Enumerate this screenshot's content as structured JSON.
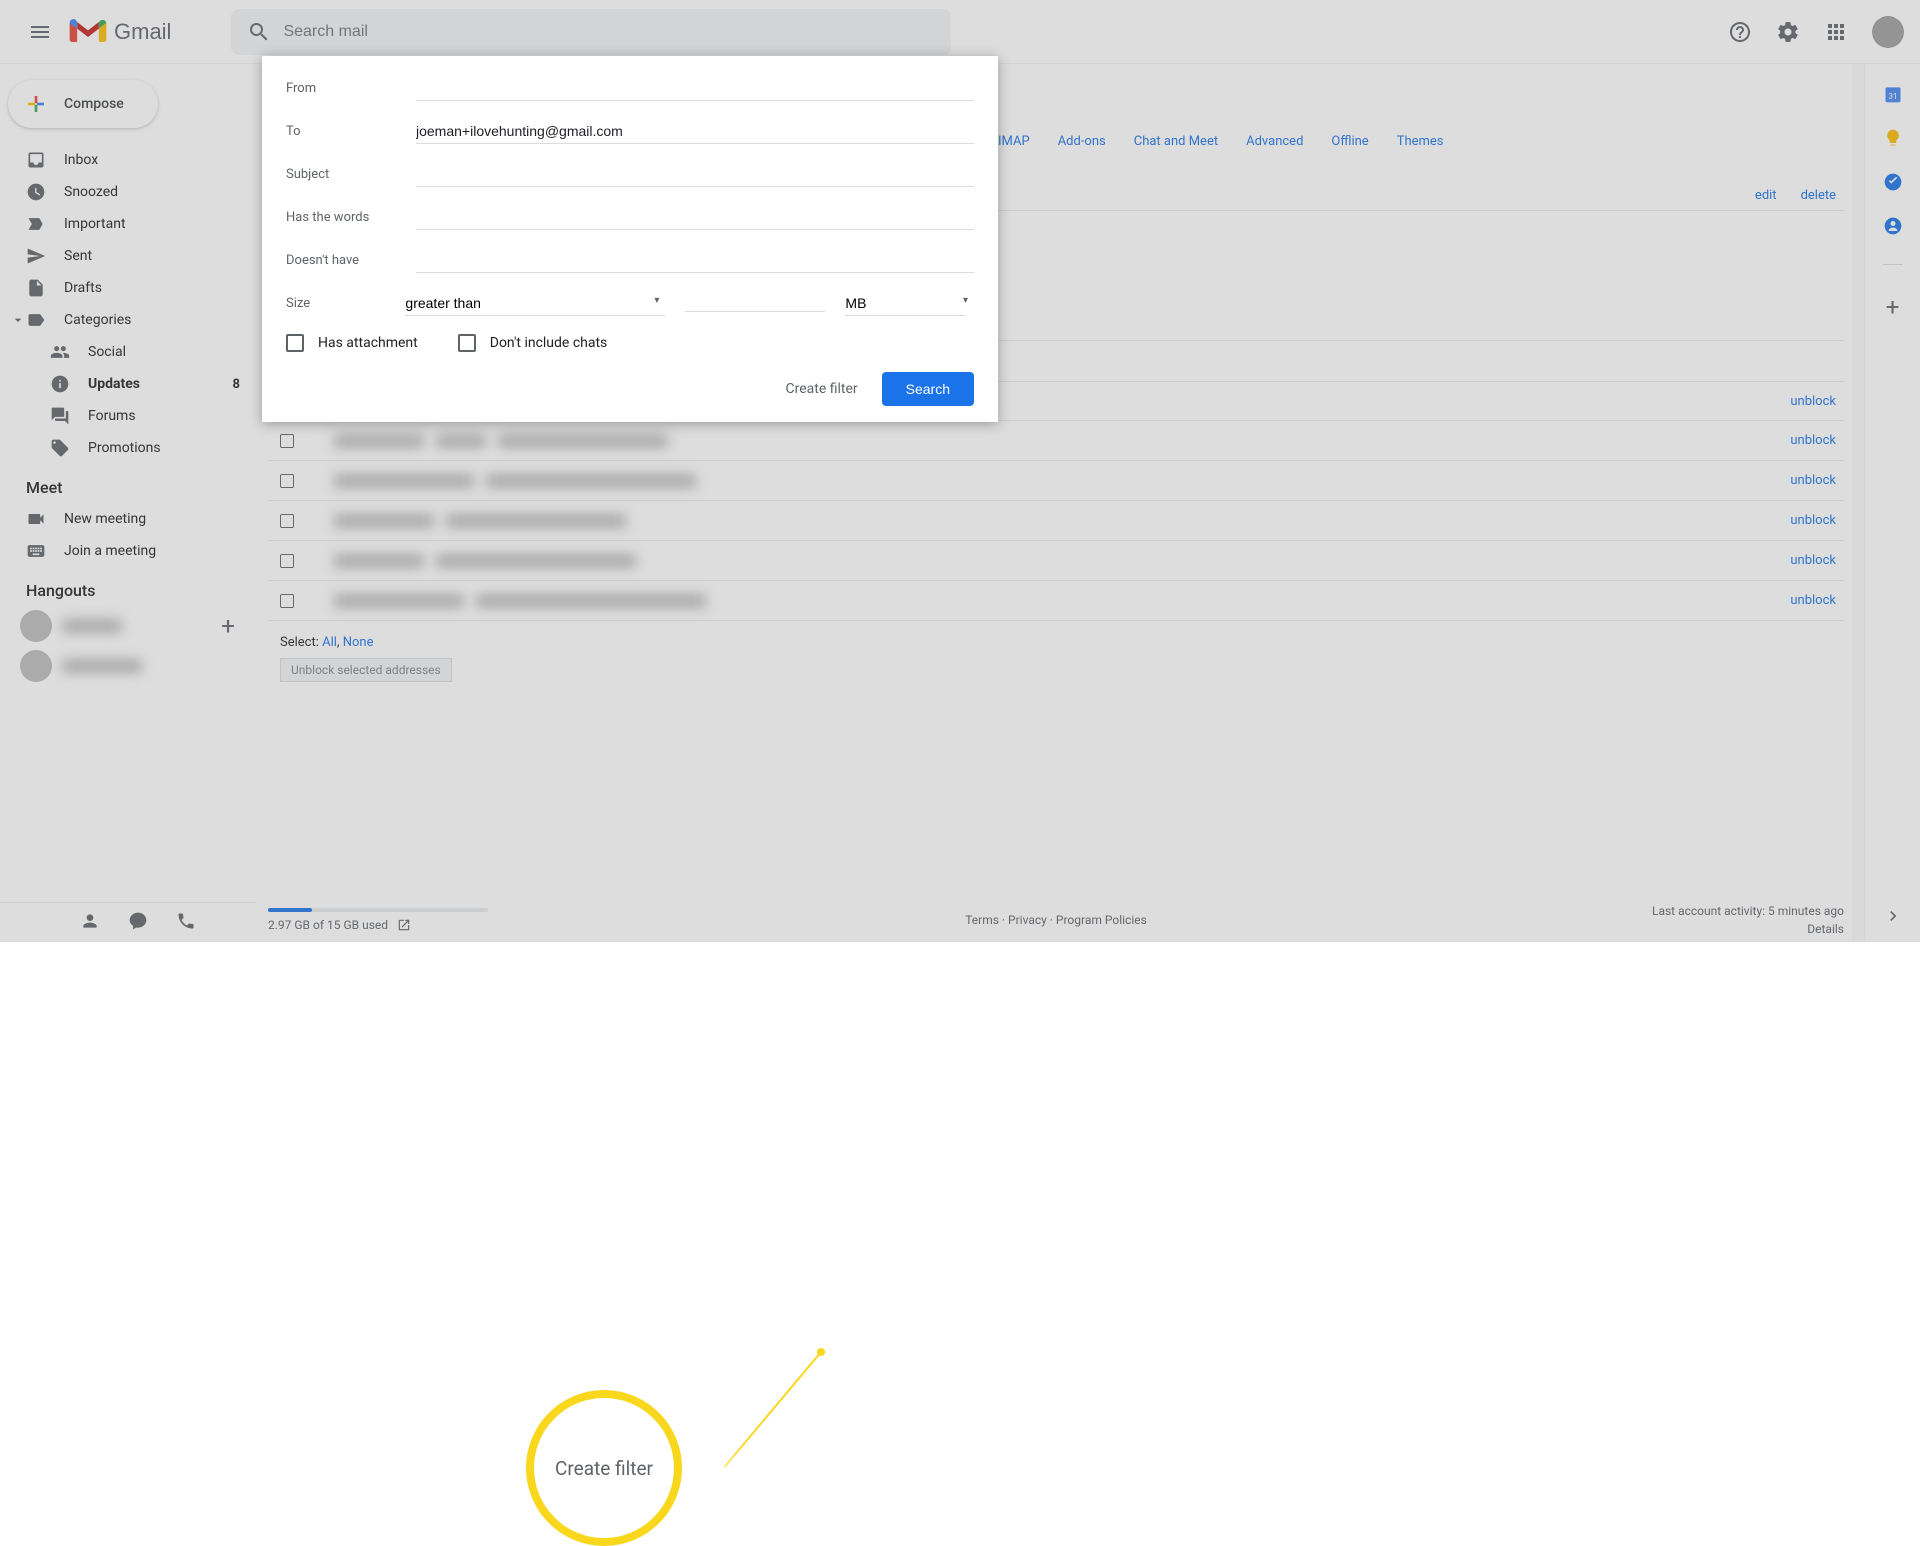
{
  "header": {
    "logo_text": "Gmail",
    "search_placeholder": "Search mail"
  },
  "sidebar": {
    "compose": "Compose",
    "items": [
      {
        "icon": "inbox",
        "label": "Inbox"
      },
      {
        "icon": "clock",
        "label": "Snoozed"
      },
      {
        "icon": "important",
        "label": "Important"
      },
      {
        "icon": "sent",
        "label": "Sent"
      },
      {
        "icon": "drafts",
        "label": "Drafts"
      }
    ],
    "categories_label": "Categories",
    "categories": [
      {
        "icon": "people",
        "label": "Social"
      },
      {
        "icon": "info",
        "label": "Updates",
        "count": "8",
        "bold": true
      },
      {
        "icon": "forums",
        "label": "Forums"
      },
      {
        "icon": "tag",
        "label": "Promotions"
      }
    ],
    "meet_header": "Meet",
    "meet_items": [
      {
        "icon": "video",
        "label": "New meeting"
      },
      {
        "icon": "keyboard",
        "label": "Join a meeting"
      }
    ],
    "hangouts_header": "Hangouts"
  },
  "settings_tabs": [
    "IMAP",
    "Add-ons",
    "Chat and Meet",
    "Advanced",
    "Offline",
    "Themes"
  ],
  "blocked": {
    "edit": "edit",
    "delete": "delete",
    "unblock": "unblock",
    "select_prefix": "Select: ",
    "select_all": "All",
    "select_none": "None",
    "unblock_selected": "Unblock selected addresses"
  },
  "filter": {
    "from": "From",
    "to": "To",
    "to_value": "joeman+ilovehunting@gmail.com",
    "subject": "Subject",
    "has_words": "Has the words",
    "doesnt_have": "Doesn't have",
    "size": "Size",
    "size_op": "greater than",
    "size_unit": "MB",
    "has_attachment": "Has attachment",
    "dont_include_chats": "Don't include chats",
    "create_filter": "Create filter",
    "search": "Search"
  },
  "callout": {
    "label": "Create filter"
  },
  "footer": {
    "storage": "2.97 GB of 15 GB used",
    "terms": "Terms",
    "privacy": "Privacy",
    "policies": "Program Policies",
    "activity": "Last account activity: 5 minutes ago",
    "details": "Details"
  }
}
